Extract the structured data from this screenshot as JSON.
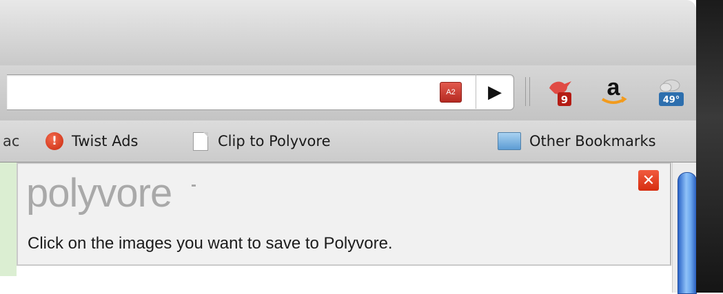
{
  "toolbar": {
    "adblock_label": "A2",
    "play_glyph": "▶",
    "icons": [
      "adblock-icon",
      "play-icon",
      "bird-notifier-icon",
      "amazon-icon",
      "weather-icon"
    ],
    "bird_badge": "9",
    "weather_temp": "49°",
    "amazon_glyph": "a"
  },
  "bookmarks": {
    "clipped_prefix": "ac",
    "twist_icon_glyph": "!",
    "twist_label": "Twist Ads",
    "clip_label": "Clip to Polyvore",
    "other_label": "Other Bookmarks"
  },
  "polyvore": {
    "logo": "polyvore",
    "message": "Click on the images you want to save to Polyvore.",
    "close_glyph": "✕"
  },
  "colors": {
    "accent_red": "#d62d10",
    "scroll_blue": "#6aa6ee"
  }
}
